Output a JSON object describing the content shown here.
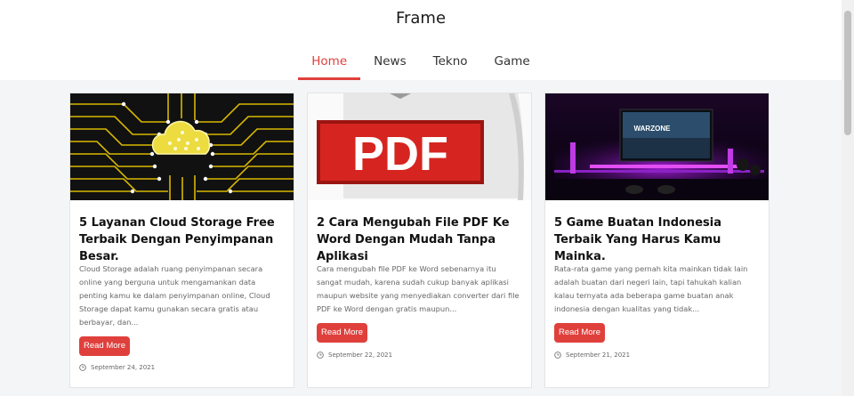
{
  "site": {
    "title": "Frame"
  },
  "nav": [
    {
      "label": "Home",
      "active": true
    },
    {
      "label": "News",
      "active": false
    },
    {
      "label": "Tekno",
      "active": false
    },
    {
      "label": "Game",
      "active": false
    }
  ],
  "posts": [
    {
      "title": "5 Layanan Cloud Storage Free Terbaik Dengan Penyimpanan Besar.",
      "excerpt": "Cloud Storage adalah ruang penyimpanan secara online yang berguna untuk mengamankan data penting kamu ke dalam penyimpanan online, Cloud Storage dapat kamu gunakan secara gratis atau berbayar, dan...",
      "read_more": "Read More",
      "date": "September 24, 2021"
    },
    {
      "title": "2 Cara Mengubah File PDF Ke Word Dengan Mudah Tanpa Aplikasi",
      "excerpt": "Cara mengubah file PDF ke Word sebenarnya itu sangat mudah, karena sudah cukup banyak aplikasi maupun website yang menyediakan converter dari file PDF ke Word dengan gratis maupun...",
      "read_more": "Read More",
      "date": "September 22, 2021",
      "thumb_text": "PDF"
    },
    {
      "title": "5 Game Buatan Indonesia Terbaik Yang Harus Kamu Mainka.",
      "excerpt": "Rata-rata game yang pernah kita mainkan tidak lain adalah buatan dari negeri lain, tapi tahukah kalian kalau ternyata ada beberapa game buatan anak indonesia dengan kualitas yang tidak...",
      "read_more": "Read More",
      "date": "September 21, 2021",
      "thumb_text": "WARZONE"
    }
  ],
  "colors": {
    "accent": "#e0403c"
  }
}
